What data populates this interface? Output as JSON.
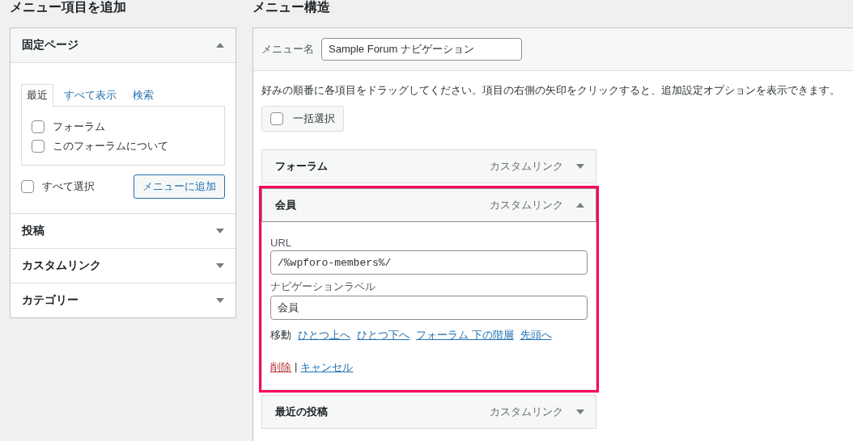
{
  "add_items": {
    "heading": "メニュー項目を追加",
    "sections": [
      {
        "title": "固定ページ",
        "expanded": true,
        "tabs": [
          {
            "label": "最近",
            "selected": true
          },
          {
            "label": "すべて表示",
            "selected": false
          },
          {
            "label": "検索",
            "selected": false
          }
        ],
        "items": [
          {
            "label": "フォーラム",
            "checked": false
          },
          {
            "label": "このフォーラムについて",
            "checked": false
          }
        ],
        "select_all": {
          "label": "すべて選択",
          "checked": false
        },
        "add_button": "メニューに追加"
      },
      {
        "title": "投稿",
        "expanded": false
      },
      {
        "title": "カスタムリンク",
        "expanded": false
      },
      {
        "title": "カテゴリー",
        "expanded": false
      }
    ]
  },
  "structure": {
    "heading": "メニュー構造",
    "menu_name_label": "メニュー名",
    "menu_name": "Sample Forum ナビゲーション",
    "instructions": "好みの順番に各項目をドラッグしてください。項目の右側の矢印をクリックすると、追加設定オプションを表示できます。",
    "bulk_select": {
      "label": "一括選択",
      "checked": false
    },
    "items": [
      {
        "title": "フォーラム",
        "type": "カスタムリンク",
        "expanded": false,
        "highlighted": false
      },
      {
        "title": "会員",
        "type": "カスタムリンク",
        "expanded": true,
        "highlighted": true,
        "url_label": "URL",
        "url": "/%wpforo-members%/",
        "nav_label_label": "ナビゲーションラベル",
        "nav_label": "会員",
        "move_label": "移動",
        "move_links": [
          "ひとつ上へ",
          "ひとつ下へ",
          "フォーラム 下の階層",
          "先頭へ"
        ],
        "delete": "削除",
        "separator": "|",
        "cancel": "キャンセル"
      },
      {
        "title": "最近の投稿",
        "type": "カスタムリンク",
        "expanded": false,
        "highlighted": false
      }
    ]
  }
}
